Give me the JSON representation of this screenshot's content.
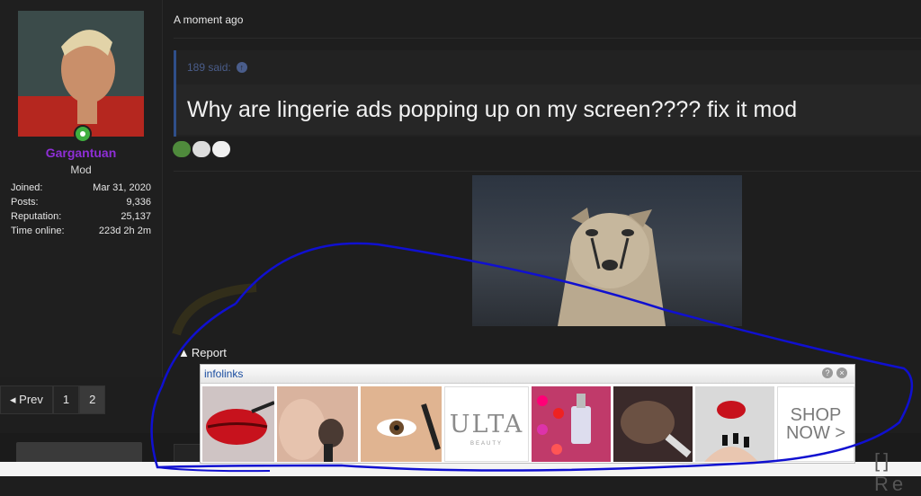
{
  "post": {
    "time": "A moment ago",
    "quote_author": "189 said:",
    "quote_text": "Why are lingerie ads popping up on my screen???? fix it mod",
    "report_label": "Report"
  },
  "user": {
    "name": "Gargantuan",
    "role": "Mod",
    "stats": [
      {
        "label": "Joined:",
        "value": "Mar 31, 2020"
      },
      {
        "label": "Posts:",
        "value": "9,336"
      },
      {
        "label": "Reputation:",
        "value": "25,137"
      },
      {
        "label": "Time online:",
        "value": "223d 2h 2m"
      }
    ]
  },
  "pagination": {
    "prev_label": "Prev",
    "pages": [
      "1",
      "2"
    ],
    "current": "2"
  },
  "ad": {
    "logo": "infolinks",
    "help": "?",
    "close": "×",
    "brand": "ULTA",
    "brand_sub": "BEAUTY",
    "cta_line1": "SHOP",
    "cta_line2": "NOW >"
  },
  "footer": {
    "corner_text": "[] Re"
  },
  "colors": {
    "username": "#8e2ed6",
    "quote_border": "#2f4f8a",
    "scribble": "#1010d0"
  }
}
